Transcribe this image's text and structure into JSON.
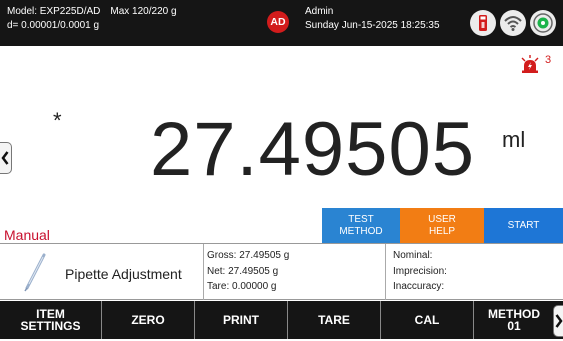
{
  "header": {
    "model": "Model: EXP225D/AD",
    "max": "Max 120/220 g",
    "resolution": "d= 0.00001/0.0001 g",
    "avatar_initials": "AD",
    "user_name": "Admin",
    "datetime": "Sunday Jun-15-2025 18:25:35",
    "icons": [
      "usb-drive-icon",
      "wifi-icon",
      "level-bubble-icon"
    ]
  },
  "main": {
    "alarm_count": "3",
    "stability_marker": "*",
    "weight": "27.49505",
    "unit": "ml",
    "mode": "Manual",
    "buttons": {
      "test_method": "TEST METHOD",
      "user_help": "USER HELP",
      "start": "START"
    }
  },
  "info": {
    "method_name": "Pipette Adjustment",
    "gross": "Gross: 27.49505 g",
    "net": "Net: 27.49505 g",
    "tare": "Tare: 0.00000 g",
    "nominal": "Nominal:",
    "imprecision": "Imprecision:",
    "inaccuracy": "Inaccuracy:"
  },
  "toolbar": {
    "item_settings": "ITEM SETTINGS",
    "zero": "ZERO",
    "print": "PRINT",
    "tare": "TARE",
    "cal": "CAL",
    "method": "METHOD 01"
  },
  "colors": {
    "header_bg": "#151515",
    "alert_red": "#d21c1c",
    "test_method_blue": "#2a84d2",
    "user_help_orange": "#f27d14",
    "start_blue": "#1e76d6"
  }
}
